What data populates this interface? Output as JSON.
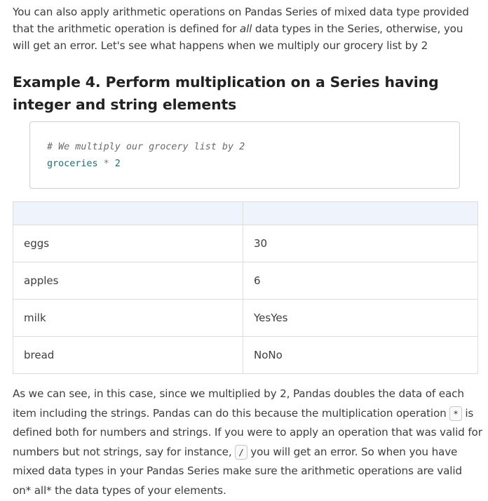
{
  "intro": {
    "before": "You can also apply arithmetic operations on Pandas Series of mixed data type provided that the arithmetic operation is defined for ",
    "emphasis": "all",
    "after": " data types in the Series, otherwise, you will get an error. Let's see what happens when we multiply our grocery list by 2"
  },
  "heading": "Example 4. Perform multiplication on a Series having integer and string elements",
  "code": {
    "comment": "# We multiply our grocery list by 2",
    "var": "groceries",
    "op": "*",
    "num": "2"
  },
  "table": {
    "headers": [
      "",
      ""
    ],
    "rows": [
      [
        "eggs",
        "30"
      ],
      [
        "apples",
        "6"
      ],
      [
        "milk",
        "YesYes"
      ],
      [
        "bread",
        "NoNo"
      ]
    ]
  },
  "outro": {
    "part1": "As we can see, in this case, since we multiplied by 2, Pandas doubles the data of each item including the strings. Pandas can do this because the multiplication operation ",
    "code1": "*",
    "part2": " is defined both for numbers and strings. If you were to apply an operation that was valid for numbers but not strings, say for instance, ",
    "code2": "/",
    "part3": " you will get an error. So when you have mixed data types in your Pandas Series make sure the arithmetic operations are valid on* all* the data types of your elements."
  }
}
